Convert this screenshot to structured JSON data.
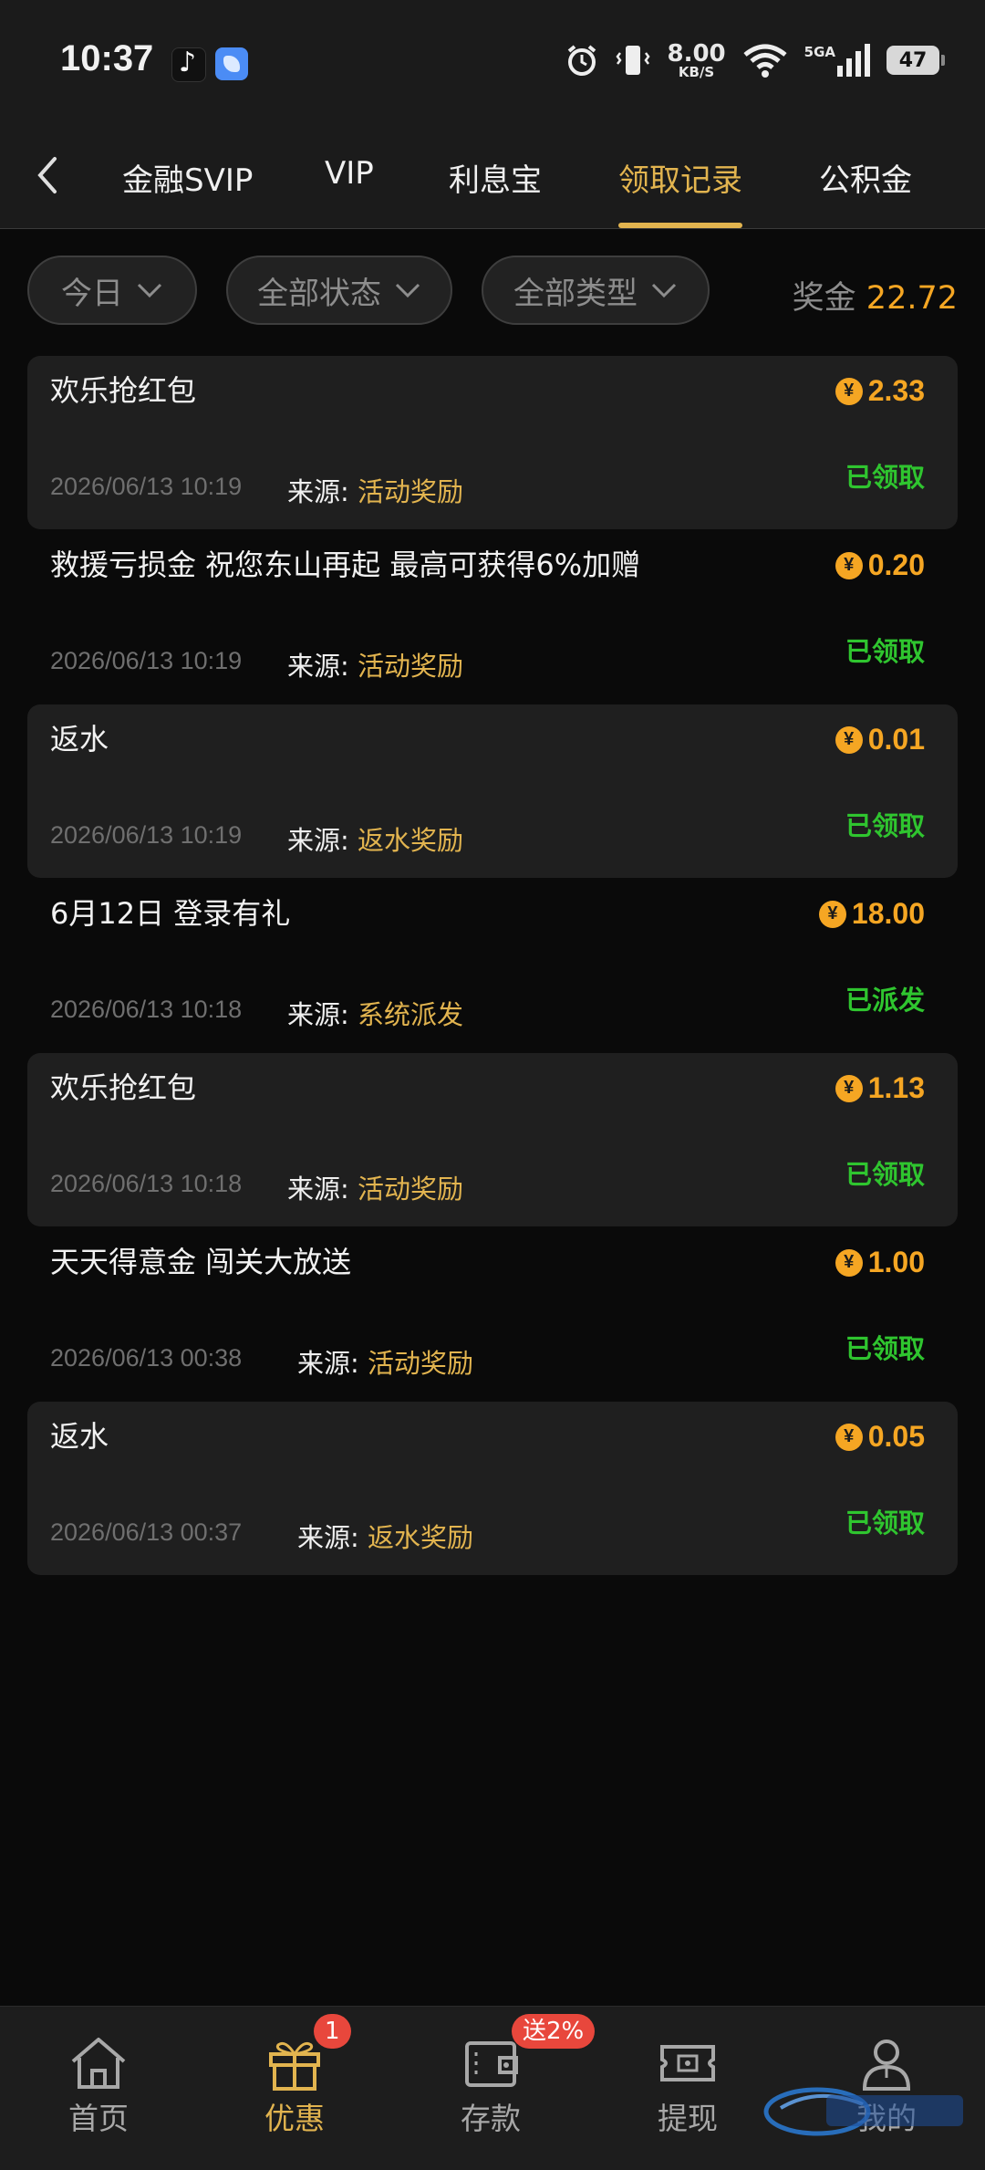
{
  "status_bar": {
    "time": "10:37",
    "net_speed_value": "8.00",
    "net_speed_unit": "KB/S",
    "network_label": "5GA",
    "battery": "47"
  },
  "tabs": [
    {
      "label": "金融SVIP"
    },
    {
      "label": "VIP"
    },
    {
      "label": "利息宝"
    },
    {
      "label": "领取记录"
    },
    {
      "label": "公积金"
    }
  ],
  "filters": {
    "date": "今日",
    "status": "全部状态",
    "type": "全部类型",
    "bonus_label": "奖金",
    "bonus_value": "22.72"
  },
  "source_label": "来源:",
  "currency_symbol": "¥",
  "records": [
    {
      "title": "欢乐抢红包",
      "amount": "2.33",
      "date": "2026/06/13 10:19",
      "source": "活动奖励",
      "status": "已领取"
    },
    {
      "title": "救援亏损金  祝您东山再起 最高可获得6%加赠",
      "amount": "0.20",
      "date": "2026/06/13 10:19",
      "source": "活动奖励",
      "status": "已领取"
    },
    {
      "title": "返水",
      "amount": "0.01",
      "date": "2026/06/13 10:19",
      "source": "返水奖励",
      "status": "已领取"
    },
    {
      "title": "6月12日 登录有礼",
      "amount": "18.00",
      "date": "2026/06/13 10:18",
      "source": "系统派发",
      "status": "已派发"
    },
    {
      "title": "欢乐抢红包",
      "amount": "1.13",
      "date": "2026/06/13 10:18",
      "source": "活动奖励",
      "status": "已领取"
    },
    {
      "title": "天天得意金 闯关大放送",
      "amount": "1.00",
      "date": "2026/06/13 00:38",
      "source": "活动奖励",
      "status": "已领取"
    },
    {
      "title": "返水",
      "amount": "0.05",
      "date": "2026/06/13 00:37",
      "source": "返水奖励",
      "status": "已领取"
    }
  ],
  "bottom_nav": [
    {
      "label": "首页",
      "icon": "home-icon"
    },
    {
      "label": "优惠",
      "icon": "gift-icon",
      "badge": "1"
    },
    {
      "label": "存款",
      "icon": "wallet-icon",
      "badge": "送2%"
    },
    {
      "label": "提现",
      "icon": "withdraw-icon"
    },
    {
      "label": "我的",
      "icon": "user-icon"
    }
  ],
  "colors": {
    "accent_gold": "#e2b44f",
    "amount_orange": "#f5a623",
    "status_green": "#2fc52f",
    "badge_red": "#e8473c"
  }
}
